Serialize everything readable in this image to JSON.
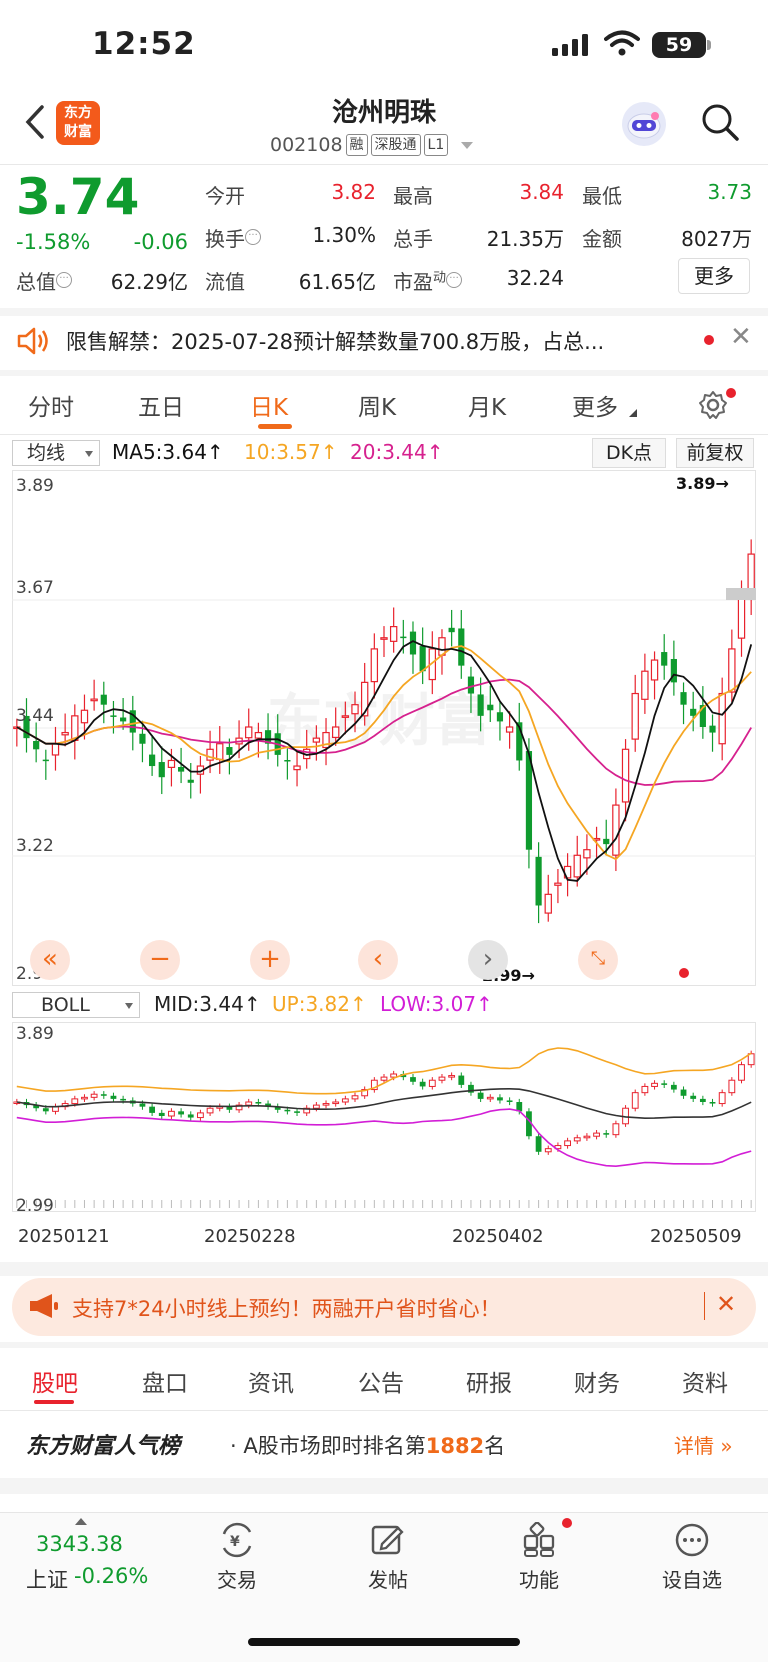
{
  "status": {
    "time": "12:52",
    "battery": "59"
  },
  "header": {
    "logo_line1": "东方",
    "logo_line2": "财富",
    "title": "沧州明珠",
    "code": "002108",
    "tags": [
      "融",
      "深股通",
      "L1"
    ]
  },
  "quote": {
    "price": "3.74",
    "pct": "-1.58%",
    "change": "-0.06",
    "rows": [
      [
        {
          "label": "今开",
          "value": "3.82",
          "color": "red"
        },
        {
          "label": "最高",
          "value": "3.84",
          "color": "red"
        },
        {
          "label": "最低",
          "value": "3.73",
          "color": "green"
        }
      ],
      [
        {
          "label": "换手",
          "value": "1.30%",
          "color": "dark"
        },
        {
          "label": "总手",
          "value": "21.35万",
          "color": "dark"
        },
        {
          "label": "金额",
          "value": "8027万",
          "color": "dark"
        }
      ],
      [
        {
          "label": "总值",
          "value": "62.29亿",
          "color": "dark"
        },
        {
          "label": "流值",
          "value": "61.65亿",
          "color": "dark"
        },
        {
          "label": "市盈",
          "value": "32.24",
          "color": "dark"
        }
      ]
    ],
    "pe_superscript": "动",
    "more_label": "更多"
  },
  "notice": {
    "text": "限售解禁：2025-07-28预计解禁数量700.8万股，占总..."
  },
  "chart_tabs": [
    "分时",
    "五日",
    "日K",
    "周K",
    "月K",
    "更多"
  ],
  "active_chart_tab": "日K",
  "ma_bar": {
    "selector": "均线",
    "ma5": "MA5:3.64↑",
    "ma10": "10:3.57↑",
    "ma20": "20:3.44↑",
    "dk_label": "DK点",
    "adjust_label": "前复权"
  },
  "kline": {
    "y_labels": [
      "3.89",
      "3.67",
      "3.44",
      "3.22",
      "2.99"
    ],
    "high_marker": "3.89→",
    "low_marker": "2.99→",
    "watermark": "东方财富"
  },
  "boll_bar": {
    "selector": "BOLL",
    "mid": "MID:3.44↑",
    "up": "UP:3.82↑",
    "low": "LOW:3.07↑",
    "y_top": "3.89",
    "y_bottom": "2.99"
  },
  "dates": [
    "20250121",
    "20250228",
    "20250402",
    "20250509"
  ],
  "promo": {
    "text": "支持7*24小时线上预约！两融开户省时省心！"
  },
  "bottom_tabs": [
    "股吧",
    "盘口",
    "资讯",
    "公告",
    "研报",
    "财务",
    "资料"
  ],
  "rank": {
    "brand": "东方财富人气榜",
    "prefix": "· A股市场即时排名第",
    "number": "1882",
    "suffix": "名",
    "detail": "详情"
  },
  "nav": {
    "index_value": "3343.38",
    "index_name": "上证",
    "index_change": "-0.26%",
    "items": [
      "交易",
      "发帖",
      "功能",
      "设自选"
    ]
  },
  "colors": {
    "up": "#e8222d",
    "down": "#0f9b2e",
    "accent": "#f06a1a",
    "ma5": "#111111",
    "ma10": "#f5a623",
    "ma20": "#d6218e"
  }
}
